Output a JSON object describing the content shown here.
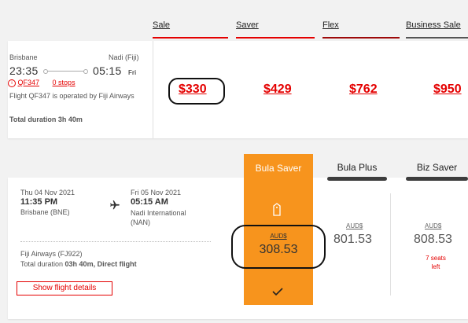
{
  "fare_headers": [
    {
      "label": "Sale",
      "color": "#e40000"
    },
    {
      "label": "Saver",
      "color": "#e40000"
    },
    {
      "label": "Flex",
      "color": "#9e0a0a"
    },
    {
      "label": "Business Sale",
      "color": "#555555"
    }
  ],
  "flight1": {
    "origin": "Brisbane",
    "destination": "Nadi (Fiji)",
    "depart_time": "23:35",
    "arrive_time": "05:15",
    "arrive_day": "Fri",
    "flight_no": "QF347",
    "stops": "0 stops",
    "operated_by": "Flight QF347 is operated by Fiji Airways",
    "duration": "Total duration 3h 40m",
    "prices": [
      "$330",
      "$429",
      "$762",
      "$950"
    ]
  },
  "flight2": {
    "depart_date": "Thu 04 Nov 2021",
    "depart_time": "11:35 PM",
    "depart_airport": "Brisbane (BNE)",
    "arrive_date": "Fri 05 Nov 2021",
    "arrive_time": "05:15 AM",
    "arrive_airport": "Nadi International (NAN)",
    "airline": "Fiji Airways (FJ922)",
    "duration_prefix": "Total duration ",
    "duration_bold": "03h 40m, Direct flight",
    "details_button": "Show flight details",
    "fare_tabs": [
      "Bula Saver",
      "Bula Plus",
      "Biz Saver"
    ],
    "currency": "AUD$",
    "prices": [
      "308.53",
      "801.53",
      "808.53"
    ],
    "seats_left": "7 seats left",
    "accent_color": "#f7941d"
  }
}
